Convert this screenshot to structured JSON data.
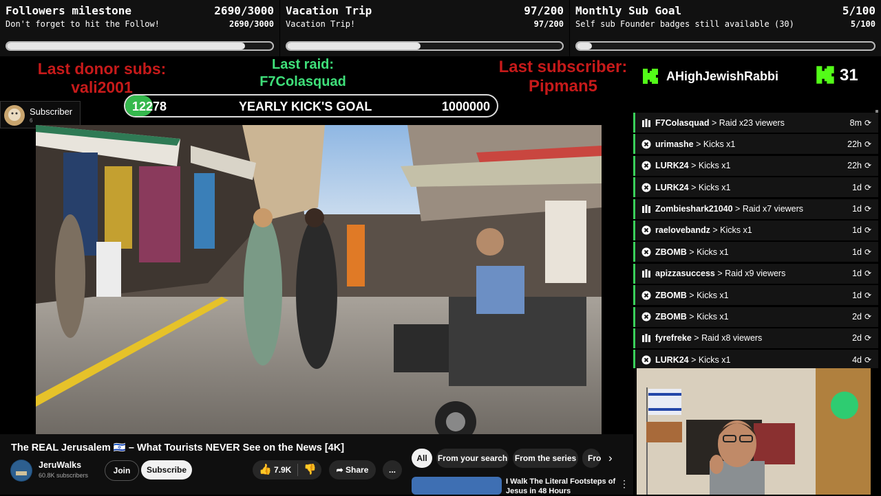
{
  "goals": [
    {
      "title": "Followers milestone",
      "count": "2690/3000",
      "subtitle": "Don't forget to hit the Follow!",
      "count2": "2690/3000",
      "progress": 0.897
    },
    {
      "title": "Vacation Trip",
      "count": "97/200",
      "subtitle": "Vacation Trip!",
      "count2": "97/200",
      "progress": 0.485
    },
    {
      "title": "Monthly Sub Goal",
      "count": "5/100",
      "subtitle": "Self sub Founder badges still available (30)",
      "count2": "5/100",
      "progress": 0.05
    }
  ],
  "last_donor": {
    "label": "Last donor subs:",
    "name": "vali2001"
  },
  "last_raid": {
    "label": "Last raid:",
    "name": "F7Colasquad"
  },
  "last_subscriber": {
    "label": "Last subscriber:",
    "name": "Pipman5"
  },
  "yearly_goal": {
    "current": "12278",
    "label": "YEARLY KICK'S GOAL",
    "target": "1000000",
    "progress": 0.0123
  },
  "sub_badge": {
    "label": "Subscriber",
    "count": "6"
  },
  "kick": {
    "username": "AHighJewishRabbi",
    "count": "31",
    "brand_color": "#53fc18"
  },
  "events": [
    {
      "type": "raid",
      "user": "F7Colasquad",
      "action": "Raid x23 viewers",
      "time": "8m"
    },
    {
      "type": "kick",
      "user": "urimashe",
      "action": "Kicks x1",
      "time": "22h"
    },
    {
      "type": "kick",
      "user": "LURK24",
      "action": "Kicks x1",
      "time": "22h"
    },
    {
      "type": "kick",
      "user": "LURK24",
      "action": "Kicks x1",
      "time": "1d"
    },
    {
      "type": "raid",
      "user": "Zombieshark21040",
      "action": "Raid x7 viewers",
      "time": "1d"
    },
    {
      "type": "kick",
      "user": "raelovebandz",
      "action": "Kicks x1",
      "time": "1d"
    },
    {
      "type": "kick",
      "user": "ZBOMB",
      "action": "Kicks x1",
      "time": "1d"
    },
    {
      "type": "raid",
      "user": "apizzasuccess",
      "action": "Raid x9 viewers",
      "time": "1d"
    },
    {
      "type": "kick",
      "user": "ZBOMB",
      "action": "Kicks x1",
      "time": "1d"
    },
    {
      "type": "kick",
      "user": "ZBOMB",
      "action": "Kicks x1",
      "time": "2d"
    },
    {
      "type": "raid",
      "user": "fyrefreke",
      "action": "Raid x8 viewers",
      "time": "2d"
    },
    {
      "type": "kick",
      "user": "LURK24",
      "action": "Kicks x1",
      "time": "4d"
    }
  ],
  "youtube": {
    "title": "The REAL Jerusalem 🇮🇱 – What Tourists NEVER See on the News [4K]",
    "channel": "JeruWalks",
    "subscribers": "60.8K subscribers",
    "join": "Join",
    "subscribe": "Subscribe",
    "likes": "7.9K",
    "share": "Share",
    "more": "...",
    "chips": [
      "All",
      "From your search",
      "From the series",
      "Fro"
    ],
    "rec_title": "I Walk The Literal Footsteps of Jesus in 48 Hours"
  }
}
